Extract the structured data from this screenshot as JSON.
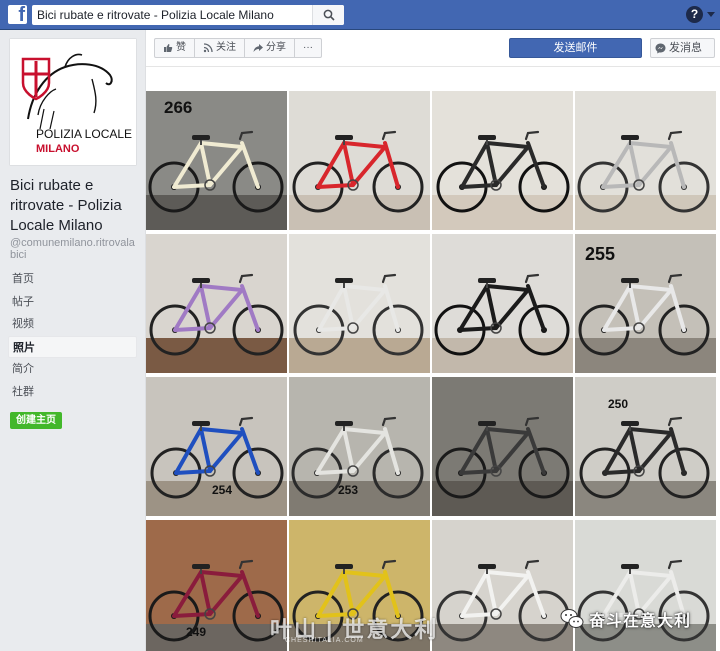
{
  "topbar": {
    "logo": "f",
    "search_value": "Bici rubate e ritrovate - Polizia Locale Milano",
    "help_label": "?"
  },
  "page": {
    "profile_logo_line1": "POLIZIA LOCALE",
    "profile_logo_line2": "MILANO",
    "name": "Bici rubate e ritrovate - Polizia Locale Milano",
    "handle": "@comunemilano.ritrovalabici"
  },
  "nav": [
    "首页",
    "帖子",
    "视频",
    "照片",
    "简介",
    "社群"
  ],
  "nav_active": "照片",
  "create_page_label": "创建主页",
  "actions": {
    "like": "赞",
    "follow": "关注",
    "share": "分享",
    "more": "···",
    "send_mail": "发送邮件",
    "message": "发消息"
  },
  "photos": [
    {
      "label": "266"
    },
    {
      "label": ""
    },
    {
      "label": ""
    },
    {
      "label": ""
    },
    {
      "label": ""
    },
    {
      "label": ""
    },
    {
      "label": ""
    },
    {
      "label": "255"
    },
    {
      "label": "254"
    },
    {
      "label": "253"
    },
    {
      "label": ""
    },
    {
      "label": "250"
    },
    {
      "label": "249"
    },
    {
      "label": ""
    },
    {
      "label": ""
    },
    {
      "label": ""
    }
  ],
  "watermark": {
    "left": "叶山 | 世意大利",
    "left_sub": "CHESHITALIA.COM",
    "right": "奋斗在意大利"
  },
  "colors": {
    "brand": "#4267b2",
    "create_button": "#42b72a"
  }
}
